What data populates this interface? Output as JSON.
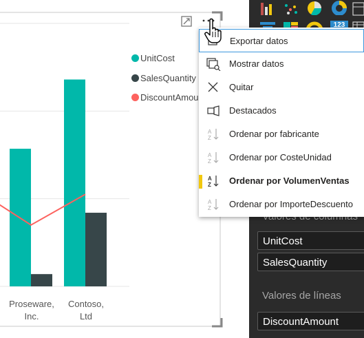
{
  "colors": {
    "unitcost": "#01B8AA",
    "salesquantity": "#374649",
    "discountamount": "#FD625E",
    "accent_selected": "#F2C80F",
    "pane_bg": "#2b2b2b"
  },
  "legend": {
    "items": [
      {
        "label": "UnitCost"
      },
      {
        "label": "SalesQuantity"
      },
      {
        "label": "DiscountAmou"
      }
    ]
  },
  "chart_data": {
    "type": "bar",
    "categories": [
      "",
      "Proseware, Inc.",
      "Contoso, Ltd"
    ],
    "x_labels": [
      [
        "",
        ""
      ],
      [
        "Proseware,",
        "Inc."
      ],
      [
        "Contoso,",
        "Ltd"
      ]
    ],
    "series": [
      {
        "name": "UnitCost",
        "kind": "bar",
        "values": [
          null,
          157,
          236
        ]
      },
      {
        "name": "SalesQuantity",
        "kind": "bar",
        "values": [
          null,
          14,
          84
        ]
      },
      {
        "name": "DiscountAmount",
        "kind": "line",
        "values": [
          112,
          70,
          105
        ]
      }
    ],
    "ylim": [
      0,
      300
    ],
    "grid": true,
    "legend_position": "top-right"
  },
  "visual_header": {
    "focus_icon": "focus-mode-icon",
    "more_icon": "more-options-icon"
  },
  "context_menu": {
    "items": [
      {
        "label": "Exportar datos",
        "icon": "export-icon"
      },
      {
        "label": "Mostrar datos",
        "icon": "show-data-icon"
      },
      {
        "label": "Quitar",
        "icon": "remove-icon"
      },
      {
        "label": "Destacados",
        "icon": "spotlight-icon"
      },
      {
        "label": "Ordenar por fabricante",
        "icon": "sort-az-icon"
      },
      {
        "label": "Ordenar por CosteUnidad",
        "icon": "sort-az-icon"
      },
      {
        "label": "Ordenar por VolumenVentas",
        "icon": "sort-az-icon"
      },
      {
        "label": "Ordenar por ImporteDescuento",
        "icon": "sort-az-icon"
      }
    ],
    "selected_index": 6,
    "hovered_index": 0
  },
  "fields_pane": {
    "column_values_label": "Valores de columnas",
    "column_fields": [
      "UnitCost",
      "SalesQuantity"
    ],
    "line_values_label": "Valores de líneas",
    "line_fields": [
      "DiscountAmount"
    ]
  }
}
